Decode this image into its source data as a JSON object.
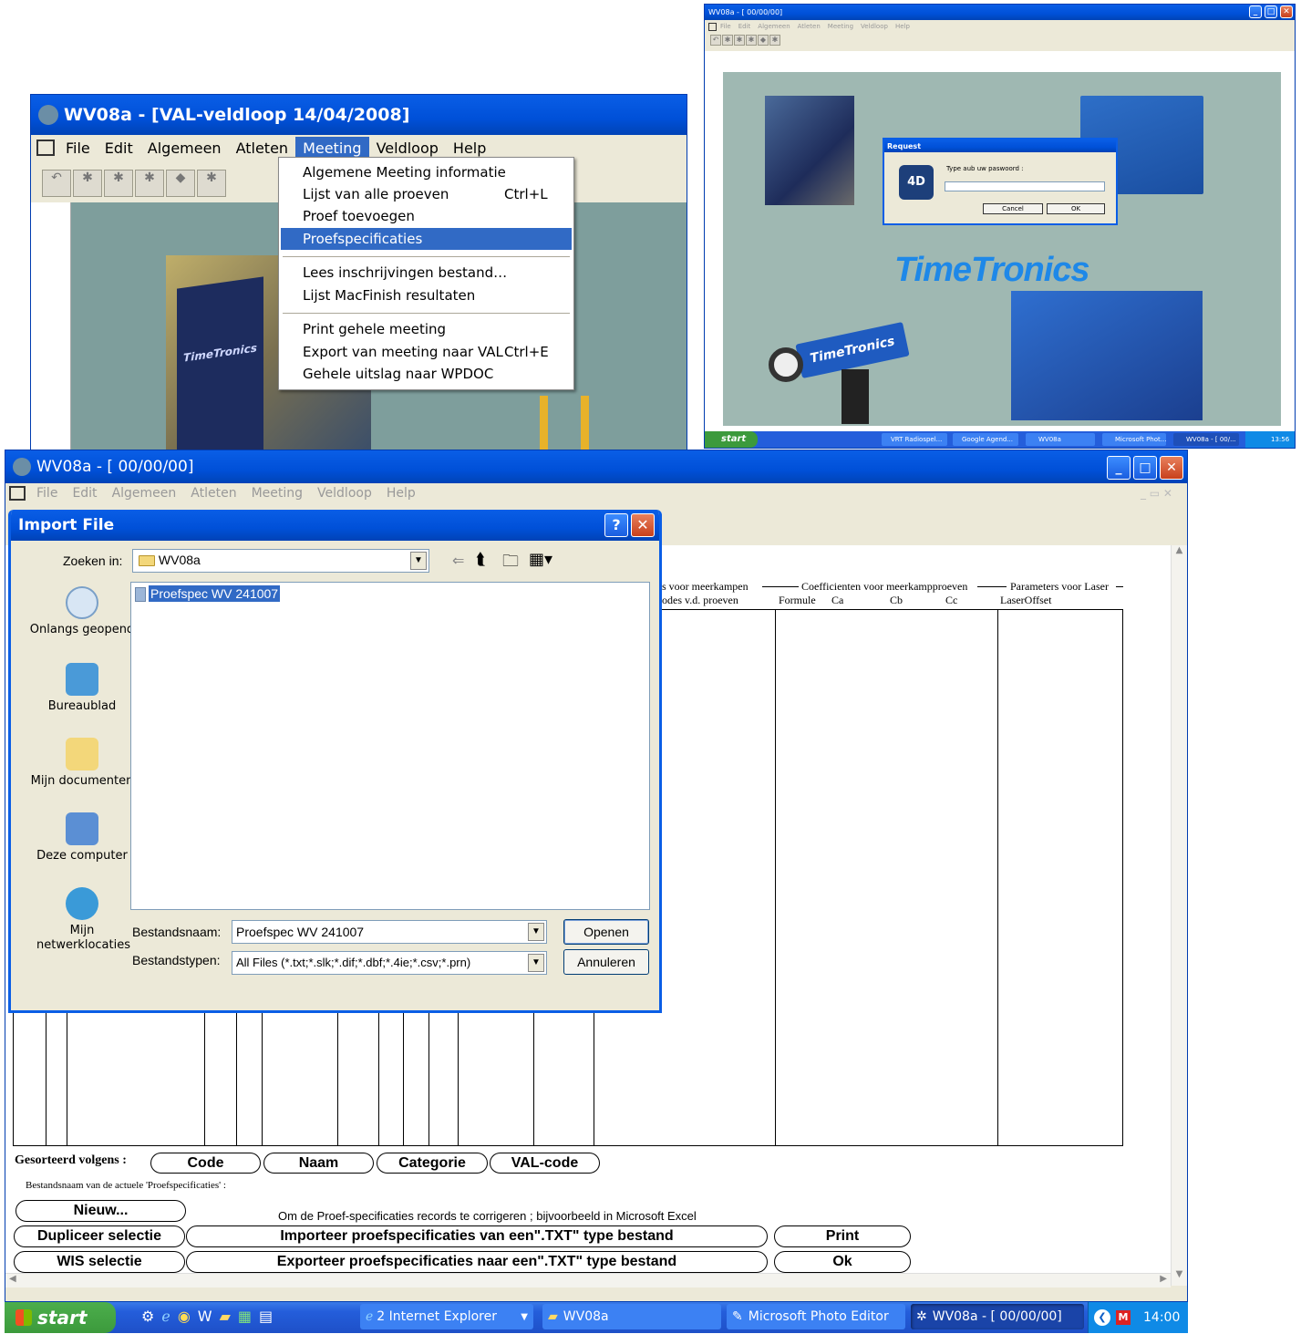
{
  "win1": {
    "title": "WV08a - [VAL-veldloop 14/04/2008]",
    "menus": [
      "File",
      "Edit",
      "Algemeen",
      "Atleten",
      "Meeting",
      "Veldloop",
      "Help"
    ],
    "dropdown": [
      {
        "label": "Algemene Meeting informatie",
        "shortcut": ""
      },
      {
        "label": "Lijst van alle proeven",
        "shortcut": "Ctrl+L"
      },
      {
        "label": "Proef toevoegen",
        "shortcut": ""
      },
      {
        "label": "Proefspecificaties",
        "shortcut": "",
        "selected": true
      },
      {
        "label": "Lees inschrijvingen bestand…",
        "shortcut": ""
      },
      {
        "label": "Lijst MacFinish resultaten",
        "shortcut": ""
      },
      {
        "label": "Print gehele meeting",
        "shortcut": ""
      },
      {
        "label": "Export van meeting naar VAL",
        "shortcut": "Ctrl+E"
      },
      {
        "label": "Gehele uitslag naar WPDOC",
        "shortcut": ""
      }
    ],
    "brand": "TimeTronics"
  },
  "win2": {
    "title": "WV08a - [ 00/00/00]",
    "menus": [
      "File",
      "Edit",
      "Algemeen",
      "Atleten",
      "Meeting",
      "Veldloop",
      "Help"
    ],
    "brand": "TimeTronics",
    "camera_label": "TimeTronics",
    "request": {
      "title": "Request",
      "prompt": "Type aub uw paswoord :",
      "cancel": "Cancel",
      "ok": "OK"
    },
    "taskbar": {
      "start": "start",
      "tasks": [
        "VRT Radiospel...",
        "Google Agend...",
        "WV08a",
        "Microsoft Phot...",
        "WV08a - [ 00/..."
      ],
      "clock": "13:56"
    }
  },
  "main": {
    "title": "WV08a - [ 00/00/00]",
    "menus": [
      "File",
      "Edit",
      "Algemeen",
      "Atleten",
      "Meeting",
      "Veldloop",
      "Help"
    ],
    "headers": {
      "meerkampen": "s voor meerkampen",
      "codes": "odes v.d. proeven",
      "coef": "Coefficienten voor meerkampproeven",
      "formule": "Formule",
      "ca": "Ca",
      "cb": "Cb",
      "cc": "Cc",
      "params": "Parameters voor Laser",
      "laseroffset": "LaserOffset"
    },
    "sort_label": "Gesorteerd volgens :",
    "sort_buttons": [
      "Code",
      "Naam",
      "Categorie",
      "VAL-code"
    ],
    "filename_label": "Bestandsnaam van de actuele 'Proefspecificaties' :",
    "hint": "Om de Proef-specificaties records te corrigeren ; bijvoorbeeld in Microsoft Excel",
    "btn_new": "Nieuw...",
    "btn_duplicate": "Dupliceer selectie",
    "btn_wis": "WIS selectie",
    "btn_import": "Importeer proefspecificaties van een\".TXT\" type bestand",
    "btn_export": "Exporteer proefspecificaties naar een\".TXT\" type bestand",
    "btn_print": "Print",
    "btn_ok": "Ok"
  },
  "dialog": {
    "title": "Import File",
    "look_in_label": "Zoeken in:",
    "look_in_value": "WV08a",
    "places": [
      "Onlangs geopend",
      "Bureaublad",
      "Mijn documenten",
      "Deze computer",
      "Mijn netwerklocaties"
    ],
    "file": "Proefspec WV 241007",
    "filename_label": "Bestandsnaam:",
    "filename_value": "Proefspec WV 241007",
    "filetype_label": "Bestandstypen:",
    "filetype_value": "All Files (*.txt;*.slk;*.dif;*.dbf;*.4ie;*.csv;*.prn)",
    "open": "Openen",
    "cancel": "Annuleren"
  },
  "taskbar": {
    "start": "start",
    "tasks": [
      "2 Internet Explorer",
      "WV08a",
      "Microsoft Photo Editor",
      "WV08a - [ 00/00/00]"
    ],
    "clock": "14:00"
  },
  "colors": {
    "xp_blue": "#0a5ee6",
    "taskbar": "#245edb",
    "start": "#3c9a3c",
    "bg_teal": "#9fb8b2",
    "brand": "#1e88e8"
  }
}
